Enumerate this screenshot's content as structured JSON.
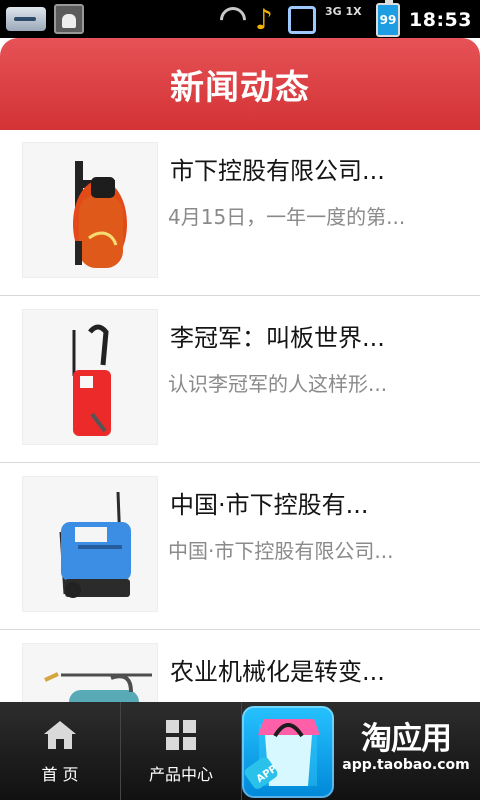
{
  "status_bar": {
    "time": "18:53",
    "network": "3G\n1X",
    "battery": "99"
  },
  "header": {
    "title": "新闻动态"
  },
  "news_items": [
    {
      "title": "市下控股有限公司...",
      "summary": "4月15日，一年一度的第..."
    },
    {
      "title": "李冠军：叫板世界...",
      "summary": "认识李冠军的人这样形..."
    },
    {
      "title": "中国·市下控股有...",
      "summary": "中国·市下控股有限公司..."
    },
    {
      "title": "农业机械化是转变...",
      "summary": ""
    }
  ],
  "bottom_nav": {
    "home_label": "首 页",
    "products_label": "产品中心",
    "app_badge": "APP",
    "brand_logo": "淘应用",
    "brand_url": "app.taobao.com"
  }
}
